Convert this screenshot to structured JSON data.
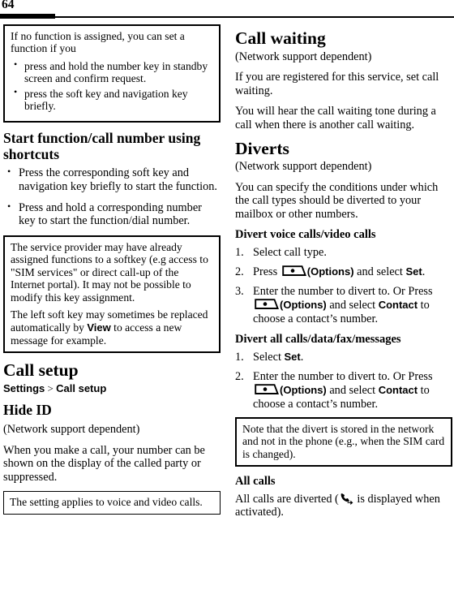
{
  "page": {
    "folio": "64"
  },
  "icons": {
    "softkey": "softkey-icon",
    "divert": "call-divert-icon"
  },
  "left_column": {
    "note_box_1": {
      "intro": "If no function is assigned, you can set a function if you",
      "bullets": [
        "press and hold the number key in standby screen and confirm request.",
        "press the soft key and navigation key briefly."
      ]
    },
    "heading_shortcuts": "Start function/call number using shortcuts",
    "shortcut_bullets": [
      "Press the corresponding soft key and navigation key briefly to start the function.",
      "Press and hold a corresponding number key to start the function/dial number."
    ],
    "note_box_2": {
      "para1": "The service provider may have already assigned functions to a softkey (e.g access to \"SIM services\" or direct call-up of the Internet portal). It may not be possible to modify this key assignment.",
      "para2_before": "The left soft key may sometimes be replaced automatically by ",
      "para2_ui": "View",
      "para2_after": " to access a new message for example."
    },
    "heading_call_setup": "Call setup",
    "breadcrumb": {
      "root": "Settings",
      "separator": ">",
      "leaf": "Call setup"
    },
    "heading_hide_id": "Hide ID",
    "hide_id_network": "(Network support dependent)",
    "hide_id_body": "When you make a call, your number can be shown on the display of the called party or suppressed.",
    "note_box_3": {
      "text": "The setting applies to voice and video calls."
    }
  },
  "right_column": {
    "heading_call_waiting": "Call waiting",
    "call_waiting_network": "(Network support dependent)",
    "call_waiting_body1": "If you are registered for this service, set call waiting.",
    "call_waiting_body2": "You will hear the call waiting tone during a call when there is another call waiting.",
    "heading_diverts": "Diverts",
    "diverts_network": "(Network support dependent)",
    "diverts_body": "You can specify the conditions under which the call types should be diverted to your mailbox or other numbers.",
    "heading_divert_voice": "Divert voice calls/video calls",
    "divert_voice_steps": {
      "step1": "Select call type.",
      "step2_before": "Press ",
      "step2_options": "(Options)",
      "step2_mid": " and select ",
      "step2_ui": "Set",
      "step2_after": ".",
      "step3_before": "Enter the number to divert to. Or Press ",
      "step3_options": "(Options)",
      "step3_mid": " and select ",
      "step3_ui": "Contact",
      "step3_after": " to choose a contact’s number."
    },
    "heading_divert_all": "Divert all calls/data/fax/messages",
    "divert_all_steps": {
      "step1_before": "Select ",
      "step1_ui": "Set",
      "step1_after": ".",
      "step2_before": "Enter the number to divert to. Or Press ",
      "step2_options": "(Options)",
      "step2_mid": " and select ",
      "step2_ui": "Contact",
      "step2_after": " to choose a contact’s number."
    },
    "note_box_divert": {
      "text": "Note that the divert is stored in the network and not in the phone (e.g., when the SIM card is changed)."
    },
    "heading_all_calls": "All calls",
    "all_calls_before": "All calls are diverted (",
    "all_calls_after": " is displayed when activated)."
  }
}
